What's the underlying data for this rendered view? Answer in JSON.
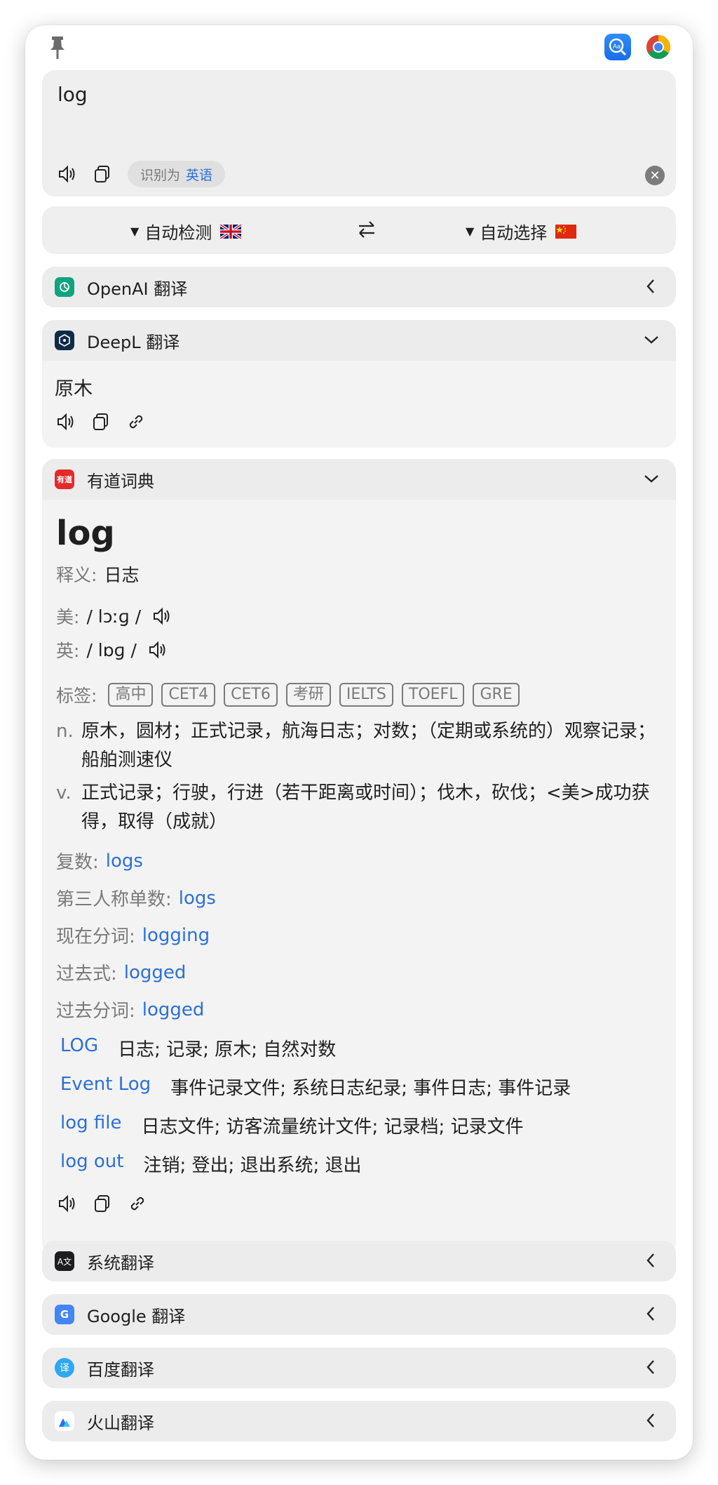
{
  "input": {
    "text": "log",
    "detected_prefix": "识别为",
    "detected_lang": "英语"
  },
  "lang_bar": {
    "from": "自动检测",
    "to": "自动选择"
  },
  "services": {
    "openai": "OpenAI 翻译",
    "deepl": "DeepL 翻译",
    "youdao": "有道词典",
    "system": "系统翻译",
    "google": "Google 翻译",
    "baidu": "百度翻译",
    "volc": "火山翻译"
  },
  "deepl_result": "原木",
  "youdao": {
    "word": "log",
    "meaning_label": "释义:",
    "meaning": "日志",
    "us_label": "美:",
    "us_phonetic": "/ lɔːɡ /",
    "uk_label": "英:",
    "uk_phonetic": "/ lɒɡ /",
    "tags_label": "标签:",
    "tags": [
      "高中",
      "CET4",
      "CET6",
      "考研",
      "IELTS",
      "TOEFL",
      "GRE"
    ],
    "definitions": [
      {
        "pos": "n.",
        "text": "原木，圆材；正式记录，航海日志；对数；（定期或系统的）观察记录；船舶测速仪"
      },
      {
        "pos": "v.",
        "text": "正式记录；行驶，行进（若干距离或时间）；伐木，砍伐；<美>成功获得，取得（成就）"
      }
    ],
    "forms": [
      {
        "label": "复数:",
        "value": "logs"
      },
      {
        "label": "第三人称单数:",
        "value": "logs"
      },
      {
        "label": "现在分词:",
        "value": "logging"
      },
      {
        "label": "过去式:",
        "value": "logged"
      },
      {
        "label": "过去分词:",
        "value": "logged"
      }
    ],
    "phrases": [
      {
        "term": "LOG",
        "meaning": "日志; 记录; 原木; 自然对数"
      },
      {
        "term": "Event Log",
        "meaning": "事件记录文件; 系统日志纪录; 事件日志; 事件记录"
      },
      {
        "term": "log file",
        "meaning": "日志文件; 访客流量统计文件; 记录档; 记录文件"
      },
      {
        "term": "log out",
        "meaning": "注销; 登出; 退出系统; 退出"
      }
    ]
  },
  "icons": [
    "pin-icon",
    "dictionary-app-icon",
    "chrome-icon",
    "speaker-icon",
    "copy-icon",
    "link-icon",
    "swap-icon",
    "chevron-left-icon",
    "chevron-down-icon",
    "clear-icon"
  ],
  "colors": {
    "accent": "#2c6fd6",
    "card_bg": "#f3f3f3",
    "header_bg": "#ececec",
    "youdao_red": "#e32a2a",
    "openai_green": "#10a37f"
  }
}
